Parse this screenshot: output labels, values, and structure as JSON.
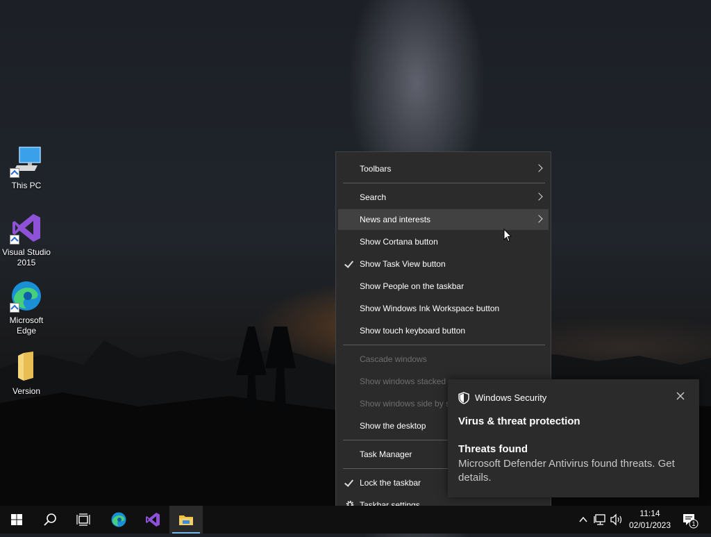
{
  "desktop": {
    "icons": [
      {
        "label": "This PC",
        "icon": "computer-icon"
      },
      {
        "label": "Visual Studio 2015",
        "icon": "visual-studio-icon"
      },
      {
        "label": "Microsoft Edge",
        "icon": "edge-icon"
      },
      {
        "label": "Version",
        "icon": "folder-icon"
      }
    ]
  },
  "context_menu": {
    "items": [
      {
        "label": "Toolbars",
        "submenu": true
      },
      {
        "label": "Search",
        "submenu": true
      },
      {
        "label": "News and interests",
        "submenu": true,
        "highlighted": true
      },
      {
        "label": "Show Cortana button"
      },
      {
        "label": "Show Task View button",
        "checked": true
      },
      {
        "label": "Show People on the taskbar"
      },
      {
        "label": "Show Windows Ink Workspace button"
      },
      {
        "label": "Show touch keyboard button"
      },
      {
        "label": "Cascade windows",
        "disabled": true
      },
      {
        "label": "Show windows stacked",
        "disabled": true
      },
      {
        "label": "Show windows side by side",
        "disabled": true
      },
      {
        "label": "Show the desktop"
      },
      {
        "label": "Task Manager"
      },
      {
        "label": "Lock the taskbar",
        "checked": true
      },
      {
        "label": "Taskbar settings",
        "icon": "gear-icon"
      }
    ]
  },
  "toast": {
    "app_name": "Windows Security",
    "title": "Virus & threat protection",
    "subtitle": "Threats found",
    "body": "Microsoft Defender Antivirus found threats. Get details."
  },
  "taskbar": {
    "buttons": [
      "start-icon",
      "search-icon",
      "task-view-icon",
      "edge-icon",
      "visual-studio-icon",
      "file-explorer-icon"
    ],
    "clock": {
      "time": "11:14",
      "date": "02/01/2023"
    },
    "notification_count": "1"
  },
  "colors": {
    "menu_bg": "#2b2b2b",
    "menu_hover": "#414141",
    "taskbar_bg": "#101010",
    "accent": "#76b9ed"
  }
}
